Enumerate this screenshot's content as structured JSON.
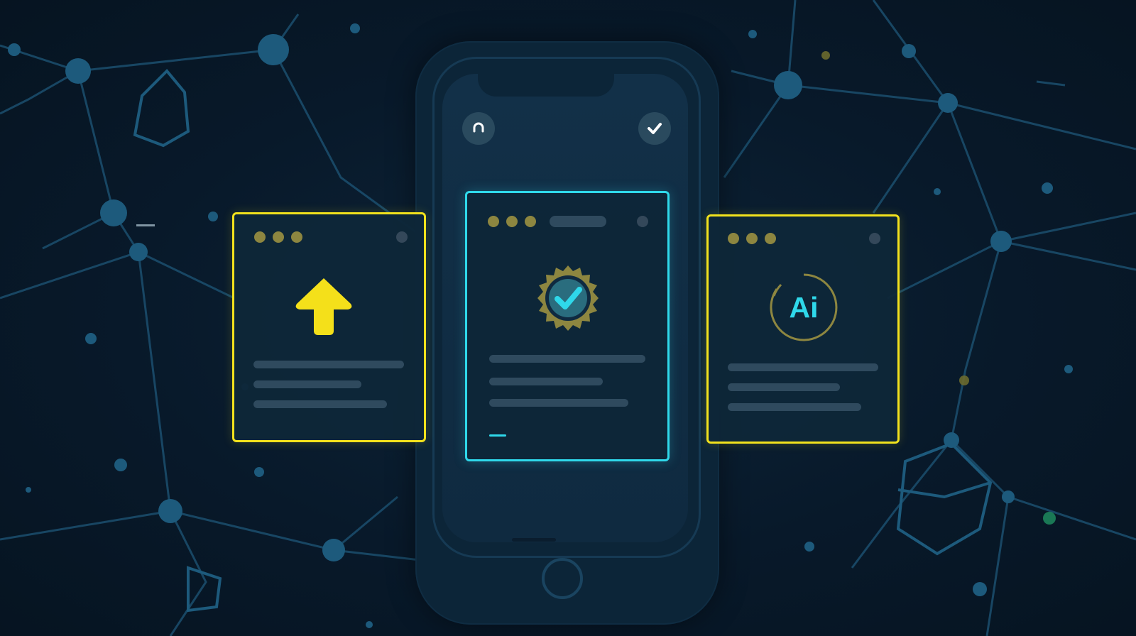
{
  "colors": {
    "background": "#08192a",
    "accent_yellow": "#f2e21d",
    "accent_cyan": "#2fd8ea",
    "network_lines": "#1b4f6e",
    "gold_badge": "#8d8640"
  },
  "phone": {
    "top_left_icon": "refresh-icon",
    "top_right_icon": "checkmark-icon"
  },
  "cards": [
    {
      "id": "upload",
      "icon": "upload-arrow-icon",
      "border": "yellow"
    },
    {
      "id": "verified",
      "icon": "verified-badge-icon",
      "border": "cyan"
    },
    {
      "id": "ai",
      "icon": "ai-icon",
      "border": "yellow",
      "icon_text": "Ai"
    }
  ]
}
